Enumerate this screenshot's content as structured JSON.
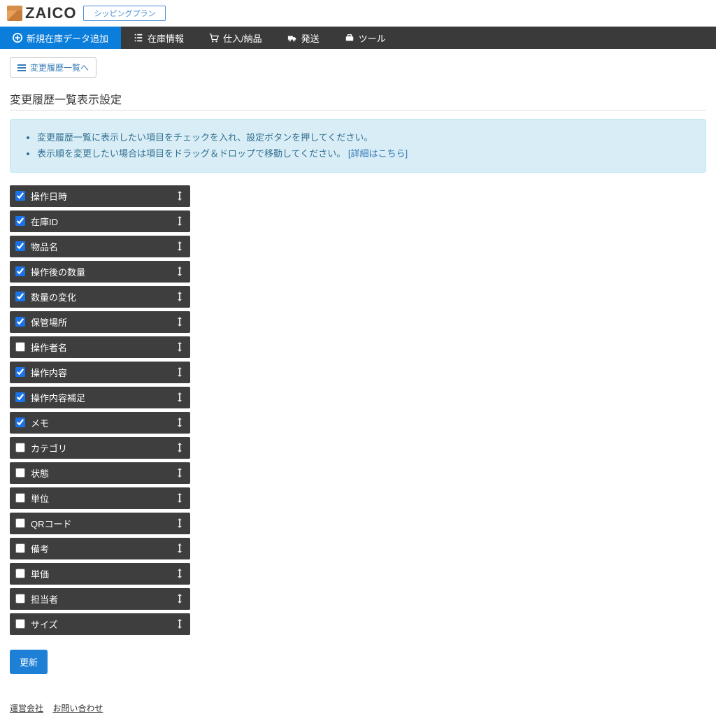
{
  "header": {
    "logo_text": "ZAICO",
    "plan_label": "シッピングプラン"
  },
  "nav": {
    "items": [
      {
        "icon": "plus-circle",
        "label": "新規在庫データ追加",
        "active": true
      },
      {
        "icon": "list",
        "label": "在庫情報",
        "active": false
      },
      {
        "icon": "cart",
        "label": "仕入/納品",
        "active": false
      },
      {
        "icon": "truck",
        "label": "発送",
        "active": false
      },
      {
        "icon": "toolbox",
        "label": "ツール",
        "active": false
      }
    ]
  },
  "back_button": "変更履歴一覧へ",
  "page_title": "変更履歴一覧表示設定",
  "info": {
    "line1": "変更履歴一覧に表示したい項目をチェックを入れ、設定ボタンを押してください。",
    "line2_prefix": "表示順を変更したい場合は項目をドラッグ＆ドロップで移動してください。",
    "link_text": "[詳細はこちら]"
  },
  "fields": [
    {
      "label": "操作日時",
      "checked": true
    },
    {
      "label": "在庫ID",
      "checked": true
    },
    {
      "label": "物品名",
      "checked": true
    },
    {
      "label": "操作後の数量",
      "checked": true
    },
    {
      "label": "数量の変化",
      "checked": true
    },
    {
      "label": "保管場所",
      "checked": true
    },
    {
      "label": "操作者名",
      "checked": false
    },
    {
      "label": "操作内容",
      "checked": true
    },
    {
      "label": "操作内容補足",
      "checked": true
    },
    {
      "label": "メモ",
      "checked": true
    },
    {
      "label": "カテゴリ",
      "checked": false
    },
    {
      "label": "状態",
      "checked": false
    },
    {
      "label": "単位",
      "checked": false
    },
    {
      "label": "QRコード",
      "checked": false
    },
    {
      "label": "備考",
      "checked": false
    },
    {
      "label": "単価",
      "checked": false
    },
    {
      "label": "担当者",
      "checked": false
    },
    {
      "label": "サイズ",
      "checked": false
    }
  ],
  "update_button": "更新",
  "footer": {
    "company": "運営会社",
    "contact": "お問い合わせ"
  }
}
